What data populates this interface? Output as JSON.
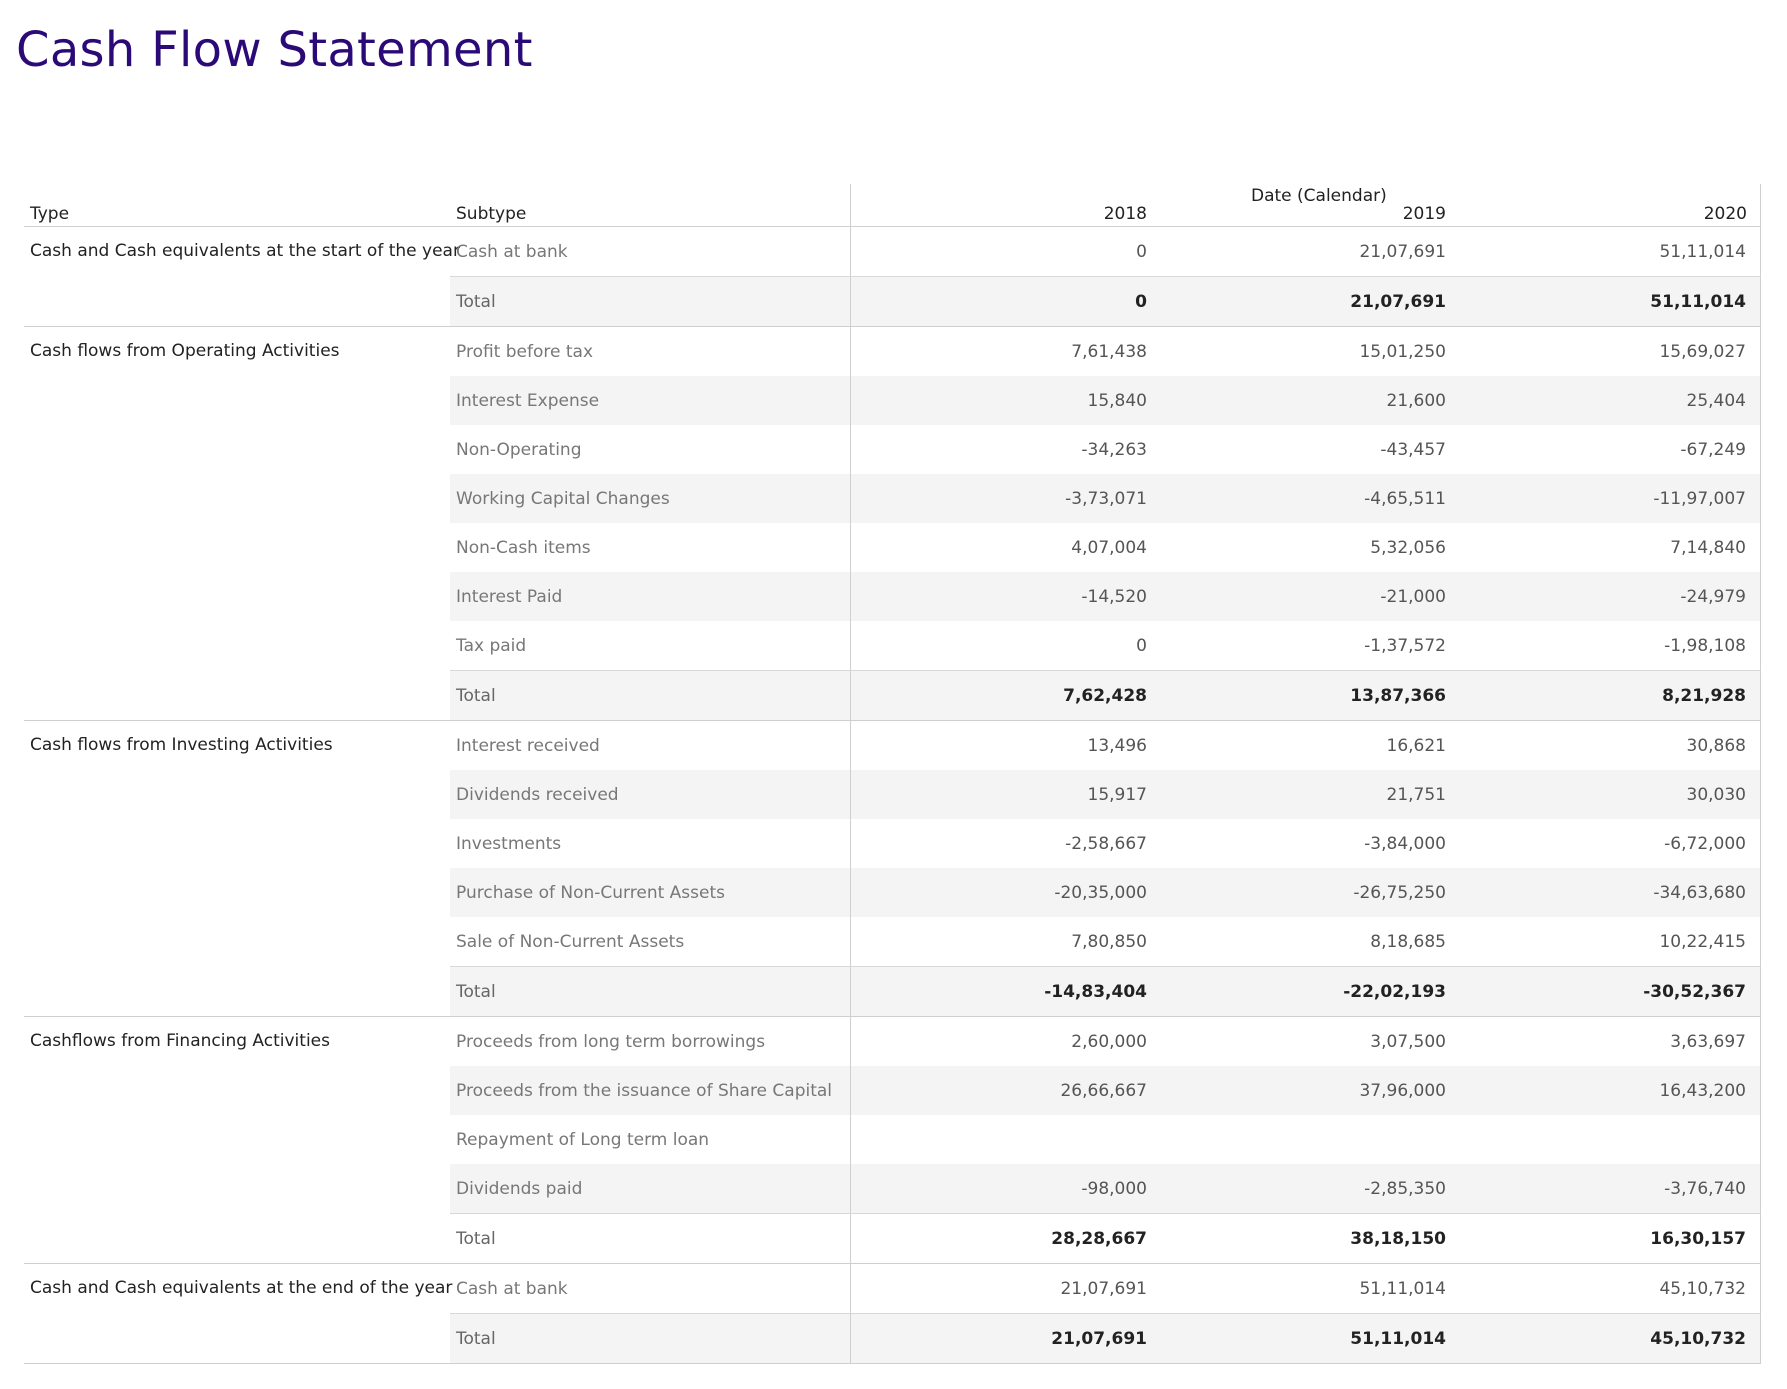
{
  "title": "Cash Flow Statement",
  "header": {
    "type_label": "Type",
    "subtype_label": "Subtype",
    "date_label": "Date (Calendar)",
    "years": [
      "2018",
      "2019",
      "2020"
    ]
  },
  "groups": [
    {
      "type": "Cash and Cash equivalents at the start of the year",
      "rows": [
        {
          "subtype": "Cash at bank",
          "values": [
            "0",
            "21,07,691",
            "51,11,014"
          ]
        },
        {
          "subtype": "Total",
          "values": [
            "0",
            "21,07,691",
            "51,11,014"
          ]
        }
      ]
    },
    {
      "type": "Cash flows from Operating Activities",
      "rows": [
        {
          "subtype": "Profit before tax",
          "values": [
            "7,61,438",
            "15,01,250",
            "15,69,027"
          ]
        },
        {
          "subtype": "Interest Expense",
          "values": [
            "15,840",
            "21,600",
            "25,404"
          ]
        },
        {
          "subtype": "Non-Operating",
          "values": [
            "-34,263",
            "-43,457",
            "-67,249"
          ]
        },
        {
          "subtype": "Working Capital Changes",
          "values": [
            "-3,73,071",
            "-4,65,511",
            "-11,97,007"
          ]
        },
        {
          "subtype": "Non-Cash items",
          "values": [
            "4,07,004",
            "5,32,056",
            "7,14,840"
          ]
        },
        {
          "subtype": "Interest Paid",
          "values": [
            "-14,520",
            "-21,000",
            "-24,979"
          ]
        },
        {
          "subtype": "Tax paid",
          "values": [
            "0",
            "-1,37,572",
            "-1,98,108"
          ]
        },
        {
          "subtype": "Total",
          "values": [
            "7,62,428",
            "13,87,366",
            "8,21,928"
          ]
        }
      ]
    },
    {
      "type": "Cash flows from Investing Activities",
      "rows": [
        {
          "subtype": "Interest received",
          "values": [
            "13,496",
            "16,621",
            "30,868"
          ]
        },
        {
          "subtype": "Dividends received",
          "values": [
            "15,917",
            "21,751",
            "30,030"
          ]
        },
        {
          "subtype": "Investments",
          "values": [
            "-2,58,667",
            "-3,84,000",
            "-6,72,000"
          ]
        },
        {
          "subtype": "Purchase of Non-Current Assets",
          "values": [
            "-20,35,000",
            "-26,75,250",
            "-34,63,680"
          ]
        },
        {
          "subtype": "Sale of Non-Current Assets",
          "values": [
            "7,80,850",
            "8,18,685",
            "10,22,415"
          ]
        },
        {
          "subtype": "Total",
          "values": [
            "-14,83,404",
            "-22,02,193",
            "-30,52,367"
          ]
        }
      ]
    },
    {
      "type": "Cashflows from Financing Activities",
      "rows": [
        {
          "subtype": "Proceeds from long term borrowings",
          "values": [
            "2,60,000",
            "3,07,500",
            "3,63,697"
          ]
        },
        {
          "subtype": "Proceeds from the issuance of Share Capital",
          "values": [
            "26,66,667",
            "37,96,000",
            "16,43,200"
          ]
        },
        {
          "subtype": "Repayment of Long term loan",
          "values": [
            "",
            "",
            ""
          ]
        },
        {
          "subtype": "Dividends paid",
          "values": [
            "-98,000",
            "-2,85,350",
            "-3,76,740"
          ]
        },
        {
          "subtype": "Total",
          "values": [
            "28,28,667",
            "38,18,150",
            "16,30,157"
          ]
        }
      ]
    },
    {
      "type": "Cash and Cash equivalents at the end of the year",
      "rows": [
        {
          "subtype": "Cash at bank",
          "values": [
            "21,07,691",
            "51,11,014",
            "45,10,732"
          ]
        },
        {
          "subtype": "Total",
          "values": [
            "21,07,691",
            "51,11,014",
            "45,10,732"
          ]
        }
      ]
    }
  ]
}
